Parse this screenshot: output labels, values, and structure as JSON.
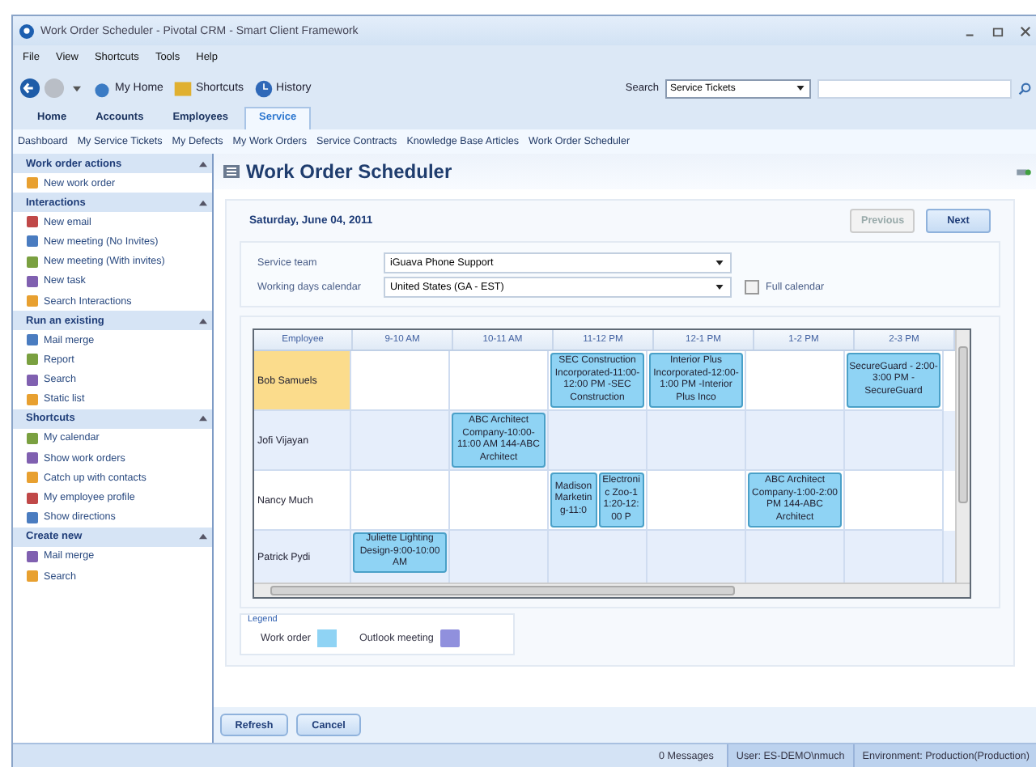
{
  "window": {
    "title": "Work Order Scheduler - Pivotal CRM - Smart Client Framework"
  },
  "menu": [
    "File",
    "View",
    "Shortcuts",
    "Tools",
    "Help"
  ],
  "toolbar": {
    "links": [
      "My Home",
      "Shortcuts",
      "History"
    ],
    "search_label": "Search",
    "search_scope": "Service Tickets"
  },
  "tabs": [
    {
      "label": "Home",
      "selected": false
    },
    {
      "label": "Accounts",
      "selected": false
    },
    {
      "label": "Employees",
      "selected": false
    },
    {
      "label": "Service",
      "selected": true
    }
  ],
  "subnav": [
    "Dashboard",
    "My Service Tickets",
    "My Defects",
    "My Work Orders",
    "Service Contracts",
    "Knowledge Base Articles",
    "Work Order Scheduler"
  ],
  "sidebar": {
    "sections": [
      {
        "title": "Work order actions",
        "items": [
          "New work order"
        ]
      },
      {
        "title": "Interactions",
        "items": [
          "New email",
          "New meeting (No Invites)",
          "New meeting (With invites)",
          "New task",
          "Search Interactions"
        ]
      },
      {
        "title": "Run an existing",
        "items": [
          "Mail merge",
          "Report",
          "Search",
          "Static list"
        ]
      },
      {
        "title": "Shortcuts",
        "items": [
          "My calendar",
          "Show work orders",
          "Catch up with contacts",
          "My employee profile",
          "Show directions"
        ]
      },
      {
        "title": "Create new",
        "items": [
          "Mail merge",
          "Search"
        ]
      }
    ]
  },
  "page": {
    "title": "Work Order Scheduler",
    "date": "Saturday, June 04, 2011",
    "buttons": [
      {
        "label": "Previous",
        "disabled": true
      },
      {
        "label": "Next",
        "disabled": false
      }
    ],
    "service_team": {
      "label": "Service team",
      "value": "iGuava Phone Support"
    },
    "calendar": {
      "label": "Working days calendar",
      "value": "United States (GA - EST)"
    },
    "full_calendar": {
      "label": "Full calendar",
      "checked": false
    },
    "schedule": {
      "columns": [
        "Employee",
        "9-10 AM",
        "10-11 AM",
        "11-12 PM",
        "12-1 PM",
        "1-2 PM",
        "2-3 PM"
      ],
      "rows": [
        {
          "employee": "Bob Samuels",
          "selected": true,
          "slots": [
            {
              "booked": false
            },
            {
              "booked": false
            },
            {
              "booked": true,
              "entries": [
                {
                  "kind": "work_order",
                  "text": "SEC Construction Incorporated-11:00-12:00 PM -SEC Construction"
                }
              ]
            },
            {
              "booked": true,
              "entries": [
                {
                  "kind": "work_order",
                  "text": "Interior Plus Incorporated-12:00-1:00 PM -Interior Plus Inco"
                }
              ]
            },
            {
              "booked": false
            },
            {
              "booked": true,
              "entries": [
                {
                  "kind": "work_order",
                  "text": "SecureGuard - 2:00-3:00 PM -SecureGuard"
                }
              ]
            }
          ]
        },
        {
          "employee": "Jofi Vijayan",
          "selected": false,
          "slots": [
            {
              "booked": false
            },
            {
              "booked": true,
              "entries": [
                {
                  "kind": "work_order",
                  "text": "ABC Architect Company-10:00-11:00 AM 144-ABC Architect"
                }
              ]
            },
            {
              "booked": false
            },
            {
              "booked": false
            },
            {
              "booked": false
            },
            {
              "booked": false
            }
          ]
        },
        {
          "employee": "Nancy Much",
          "selected": false,
          "slots": [
            {
              "booked": false
            },
            {
              "booked": false
            },
            {
              "booked": true,
              "entries": [
                {
                  "kind": "work_order",
                  "text": "Madison Marketing-11:0"
                },
                {
                  "kind": "work_order",
                  "text": "Electronic Zoo-11:20-12:00 P"
                }
              ]
            },
            {
              "booked": false
            },
            {
              "booked": true,
              "entries": [
                {
                  "kind": "work_order",
                  "text": "ABC Architect Company-1:00-2:00 PM 144-ABC Architect"
                }
              ]
            },
            {
              "booked": false
            }
          ]
        },
        {
          "employee": "Patrick Pydi",
          "selected": false,
          "slots": [
            {
              "booked": true,
              "entries": [
                {
                  "kind": "work_order",
                  "text": "Juliette Lighting Design-9:00-10:00 AM"
                }
              ]
            },
            {
              "booked": false
            },
            {
              "booked": false
            },
            {
              "booked": false
            },
            {
              "booked": false
            },
            {
              "booked": false
            }
          ]
        }
      ]
    },
    "legend": {
      "title": "Legend",
      "items": [
        {
          "kind": "work_order",
          "label": "Work order",
          "color": "#8fd3f4"
        },
        {
          "kind": "outlook_meeting",
          "label": "Outlook meeting",
          "color": "#9090dd"
        }
      ]
    },
    "actions": [
      "Refresh",
      "Cancel"
    ]
  },
  "status_bar": [
    "0 Messages",
    "User: ES-DEMO\\nmuch",
    "Environment: Production(Production)"
  ]
}
